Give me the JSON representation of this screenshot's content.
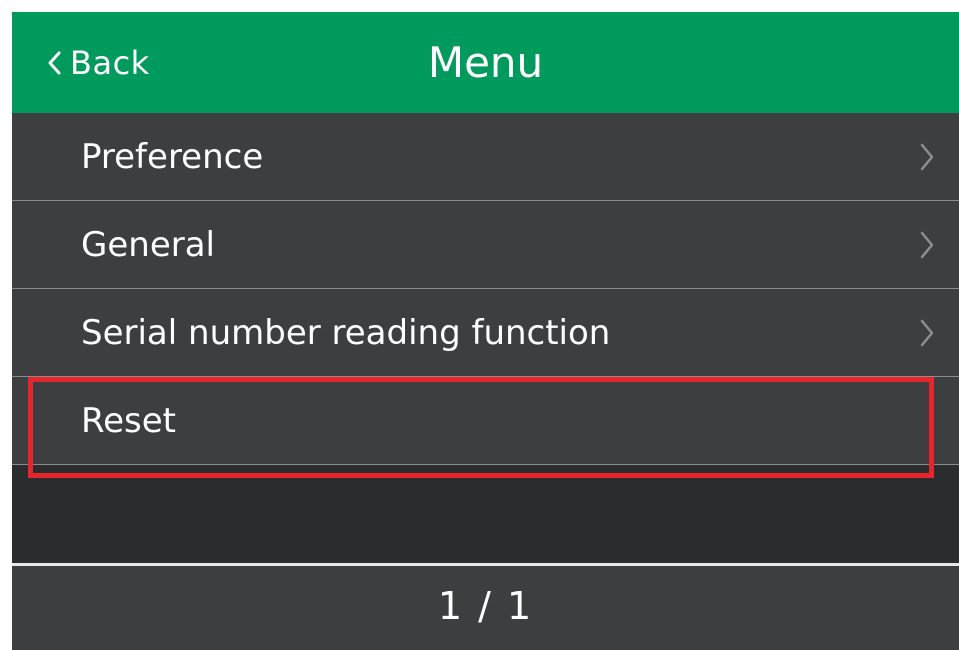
{
  "header": {
    "back_label": "Back",
    "title": "Menu"
  },
  "menu": {
    "items": [
      {
        "label": "Preference",
        "has_chevron": true
      },
      {
        "label": "General",
        "has_chevron": true
      },
      {
        "label": "Serial number reading function",
        "has_chevron": true
      },
      {
        "label": "Reset",
        "has_chevron": false
      }
    ]
  },
  "footer": {
    "page_indicator": "1 / 1"
  },
  "colors": {
    "header_bg": "#009a5c",
    "item_bg": "#3d3e40",
    "screen_bg": "#2b2c2e",
    "highlight": "#e5262c",
    "text": "#ffffff"
  },
  "icons": {
    "back": "chevron-left-icon",
    "item_arrow": "chevron-right-icon"
  }
}
